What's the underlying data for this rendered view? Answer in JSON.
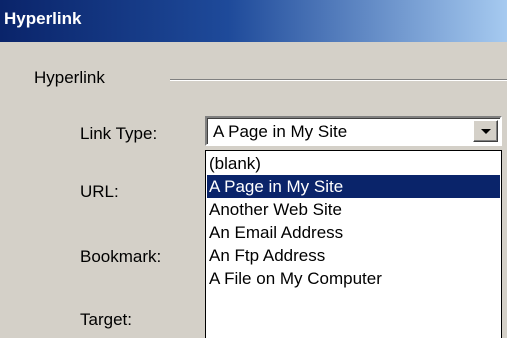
{
  "window": {
    "title": "Hyperlink"
  },
  "group": {
    "label": "Hyperlink"
  },
  "fields": {
    "link_type": {
      "label": "Link Type:",
      "value": "A Page in My Site"
    },
    "url": {
      "label": "URL:"
    },
    "bookmark": {
      "label": "Bookmark:"
    },
    "target": {
      "label": "Target:",
      "value": ""
    }
  },
  "dropdown": {
    "options": [
      "(blank)",
      "A Page in My Site",
      "Another Web Site",
      "An Email Address",
      "An Ftp Address",
      "A File on My Computer"
    ],
    "selected_index": 1
  },
  "colors": {
    "title_bar": "#0a246a",
    "selection_bg": "#0a246a",
    "selection_text": "#ffffff",
    "dialog_bg": "#d4d0c8"
  },
  "icons": {
    "dropdown_arrow": "chevron-down-icon"
  }
}
